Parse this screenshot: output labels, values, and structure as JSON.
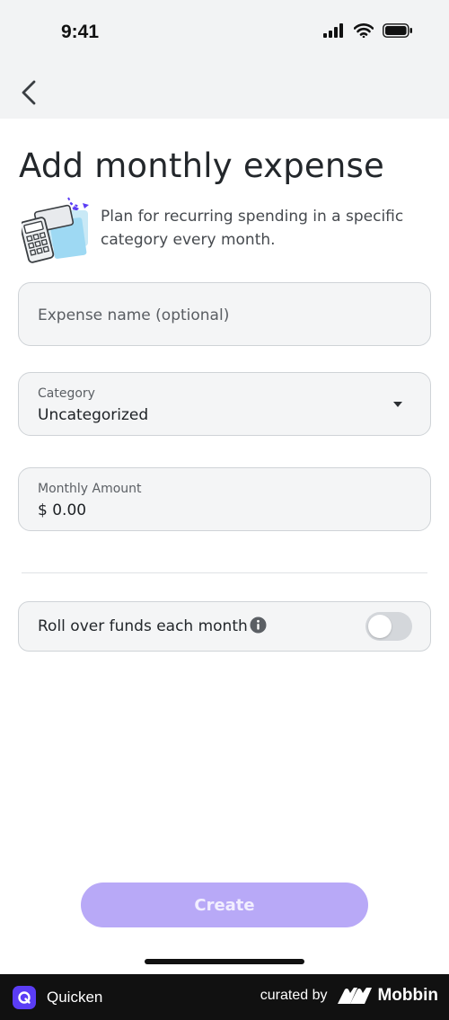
{
  "status_bar": {
    "time": "9:41"
  },
  "header": {
    "title": "Add monthly expense"
  },
  "intro": {
    "description": "Plan for recurring spending in a specific category every month."
  },
  "form": {
    "expense_name": {
      "placeholder": "Expense name (optional)",
      "value": ""
    },
    "category": {
      "label": "Category",
      "value": "Uncategorized"
    },
    "monthly_amount": {
      "label": "Monthly Amount",
      "value": "$ 0.00"
    },
    "rollover": {
      "label": "Roll over funds each month",
      "enabled": false
    }
  },
  "actions": {
    "create_label": "Create"
  },
  "footer": {
    "app_name": "Quicken",
    "curated_by": "curated by",
    "curator": "Mobbin"
  },
  "colors": {
    "accent": "#5b3df5",
    "create_button_disabled": "#b8a9f7",
    "field_background": "#f4f5f6",
    "field_border": "#cfd3d7",
    "header_background": "#f2f3f4"
  },
  "icons": [
    "back-chevron-icon",
    "signal-icon",
    "wifi-icon",
    "battery-icon",
    "caret-down-icon",
    "info-icon",
    "quicken-logo-icon",
    "mobbin-logo-icon"
  ]
}
